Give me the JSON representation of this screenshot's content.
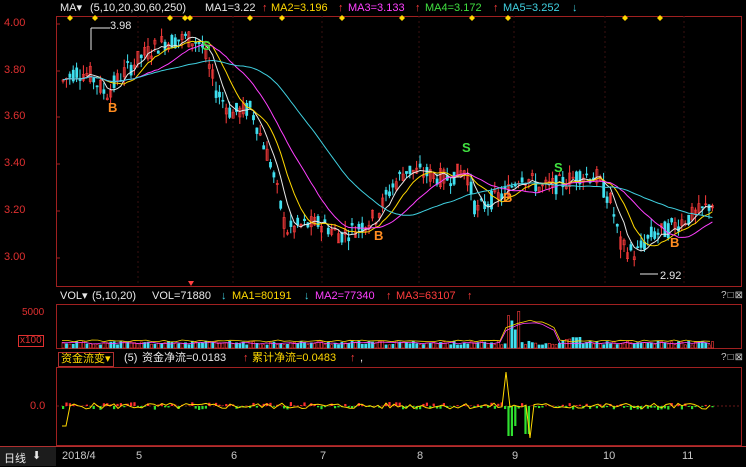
{
  "main": {
    "ma_selector": "MA▾",
    "params": "(5,10,20,30,60,250)",
    "ma1": "MA1=3.22",
    "ma2": "MA2=3.196",
    "ma3": "MA3=3.133",
    "ma4": "MA4=3.172",
    "ma5": "MA5=3.252",
    "arrow_up": "↑",
    "arrow_down": "↓",
    "y_ticks": [
      "4.00",
      "3.80",
      "3.60",
      "3.40",
      "3.20",
      "3.00"
    ],
    "high_label": "3.98",
    "low_label": "2.92",
    "signals": [
      {
        "type": "B",
        "label": "B"
      },
      {
        "type": "S",
        "label": "S"
      },
      {
        "type": "B",
        "label": "B"
      },
      {
        "type": "S",
        "label": "S"
      },
      {
        "type": "B",
        "label": "B"
      },
      {
        "type": "S",
        "label": "S"
      },
      {
        "type": "B",
        "label": "B"
      }
    ]
  },
  "volume": {
    "selector": "VOL▾",
    "params": "(5,10,20)",
    "vol": "VOL=71880",
    "ma1": "MA1=80191",
    "ma2": "MA2=77340",
    "ma3": "MA3=63107",
    "y_tick": "5000",
    "unit": "x100"
  },
  "flow": {
    "selector": "资金流变▾",
    "params": "(5)",
    "net": "资金净流=0.0183",
    "cumulative": "累计净流=0.0483",
    "comma": ",",
    "y_tick": "0.0"
  },
  "controls": "?□⊠",
  "date_axis": {
    "period": "日线",
    "period_arrow": "⬇",
    "labels": [
      "2018/4",
      "5",
      "6",
      "7",
      "8",
      "9",
      "10",
      "11"
    ]
  },
  "colors": {
    "up": "#ff3c3c",
    "down": "#40e0f0",
    "ma1": "#e8e8e8",
    "ma2": "#ffd800",
    "ma3": "#ff40ff",
    "ma5": "#40d0e0"
  }
}
